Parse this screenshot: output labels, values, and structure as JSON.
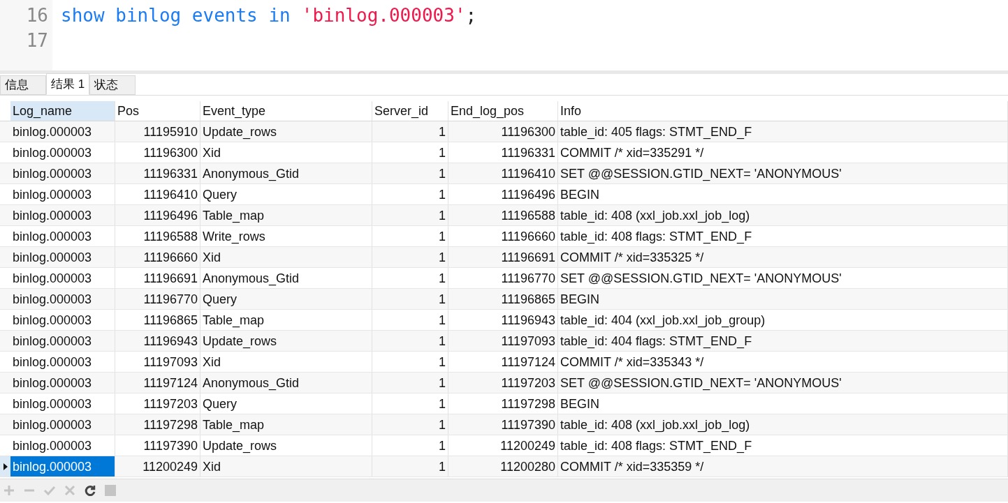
{
  "editor": {
    "lines": [
      {
        "number": "16",
        "tokens": [
          {
            "kind": "keyword",
            "text": "show binlog events in"
          },
          {
            "kind": "string",
            "text": "'binlog.000003'"
          },
          {
            "kind": "punct",
            "text": ";"
          }
        ]
      },
      {
        "number": "17"
      }
    ]
  },
  "tabs": [
    {
      "label": "信息",
      "selected": false
    },
    {
      "label": "结果 1",
      "selected": true
    },
    {
      "label": "状态",
      "selected": false
    }
  ],
  "table": {
    "columns": [
      {
        "label": "Log_name",
        "selected": true
      },
      {
        "label": "Pos",
        "selected": false
      },
      {
        "label": "Event_type",
        "selected": false
      },
      {
        "label": "Server_id",
        "selected": false
      },
      {
        "label": "End_log_pos",
        "selected": false
      },
      {
        "label": "Info",
        "selected": false
      }
    ],
    "rows": [
      {
        "selected": false,
        "cells": [
          "binlog.000003",
          "11195910",
          "Update_rows",
          "1",
          "11196300",
          "table_id: 405 flags: STMT_END_F"
        ]
      },
      {
        "selected": false,
        "cells": [
          "binlog.000003",
          "11196300",
          "Xid",
          "1",
          "11196331",
          "COMMIT /* xid=335291 */"
        ]
      },
      {
        "selected": false,
        "cells": [
          "binlog.000003",
          "11196331",
          "Anonymous_Gtid",
          "1",
          "11196410",
          "SET @@SESSION.GTID_NEXT= 'ANONYMOUS'"
        ]
      },
      {
        "selected": false,
        "cells": [
          "binlog.000003",
          "11196410",
          "Query",
          "1",
          "11196496",
          "BEGIN"
        ]
      },
      {
        "selected": false,
        "cells": [
          "binlog.000003",
          "11196496",
          "Table_map",
          "1",
          "11196588",
          "table_id: 408 (xxl_job.xxl_job_log)"
        ]
      },
      {
        "selected": false,
        "cells": [
          "binlog.000003",
          "11196588",
          "Write_rows",
          "1",
          "11196660",
          "table_id: 408 flags: STMT_END_F"
        ]
      },
      {
        "selected": false,
        "cells": [
          "binlog.000003",
          "11196660",
          "Xid",
          "1",
          "11196691",
          "COMMIT /* xid=335325 */"
        ]
      },
      {
        "selected": false,
        "cells": [
          "binlog.000003",
          "11196691",
          "Anonymous_Gtid",
          "1",
          "11196770",
          "SET @@SESSION.GTID_NEXT= 'ANONYMOUS'"
        ]
      },
      {
        "selected": false,
        "cells": [
          "binlog.000003",
          "11196770",
          "Query",
          "1",
          "11196865",
          "BEGIN"
        ]
      },
      {
        "selected": false,
        "cells": [
          "binlog.000003",
          "11196865",
          "Table_map",
          "1",
          "11196943",
          "table_id: 404 (xxl_job.xxl_job_group)"
        ]
      },
      {
        "selected": false,
        "cells": [
          "binlog.000003",
          "11196943",
          "Update_rows",
          "1",
          "11197093",
          "table_id: 404 flags: STMT_END_F"
        ]
      },
      {
        "selected": false,
        "cells": [
          "binlog.000003",
          "11197093",
          "Xid",
          "1",
          "11197124",
          "COMMIT /* xid=335343 */"
        ]
      },
      {
        "selected": false,
        "cells": [
          "binlog.000003",
          "11197124",
          "Anonymous_Gtid",
          "1",
          "11197203",
          "SET @@SESSION.GTID_NEXT= 'ANONYMOUS'"
        ]
      },
      {
        "selected": false,
        "cells": [
          "binlog.000003",
          "11197203",
          "Query",
          "1",
          "11197298",
          "BEGIN"
        ]
      },
      {
        "selected": false,
        "cells": [
          "binlog.000003",
          "11197298",
          "Table_map",
          "1",
          "11197390",
          "table_id: 408 (xxl_job.xxl_job_log)"
        ]
      },
      {
        "selected": false,
        "cells": [
          "binlog.000003",
          "11197390",
          "Update_rows",
          "1",
          "11200249",
          "table_id: 408 flags: STMT_END_F"
        ]
      },
      {
        "selected": true,
        "cells": [
          "binlog.000003",
          "11200249",
          "Xid",
          "1",
          "11200280",
          "COMMIT /* xid=335359 */"
        ]
      }
    ]
  },
  "toolbar": [
    {
      "disabled": true
    },
    {
      "disabled": true
    },
    {
      "disabled": true
    },
    {
      "disabled": true
    },
    {
      "disabled": false
    },
    {
      "disabled": true
    }
  ]
}
